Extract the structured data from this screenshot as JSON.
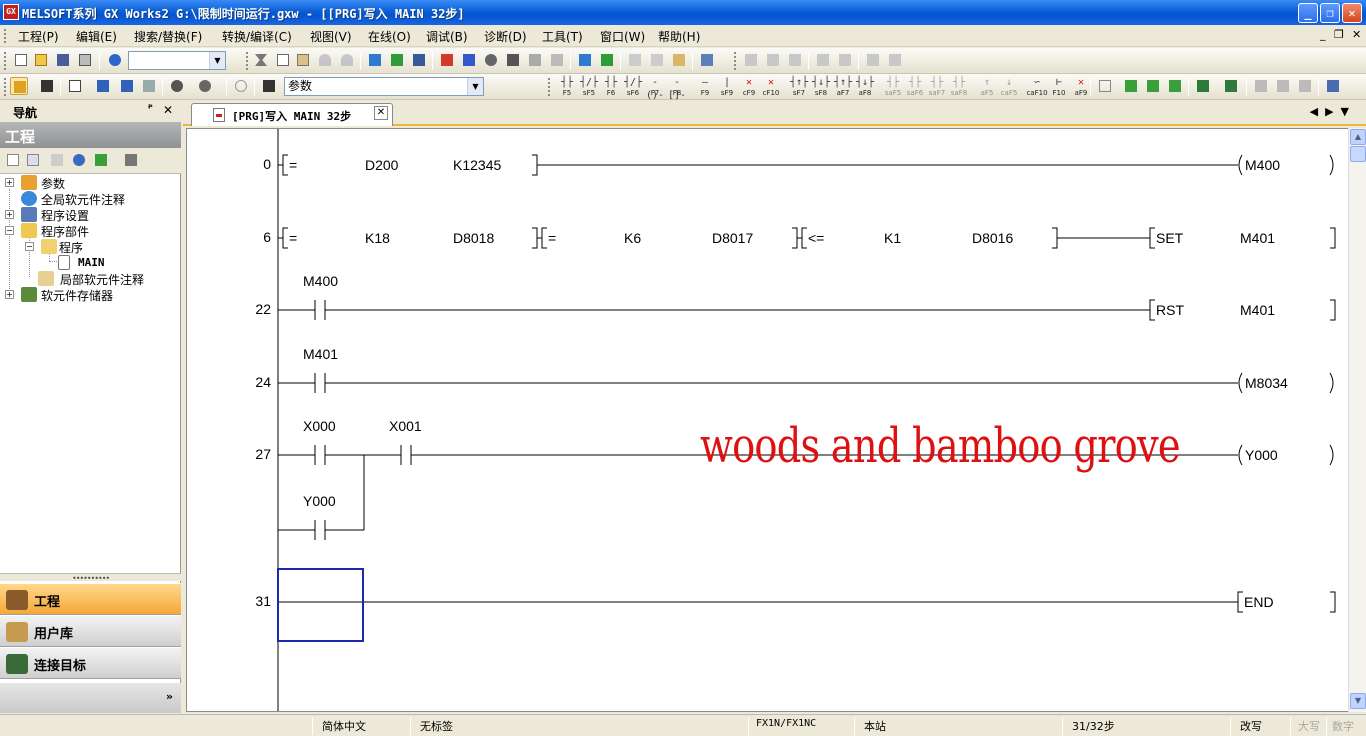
{
  "window": {
    "title": "MELSOFT系列 GX Works2 G:\\限制时间运行.gxw - [[PRG]写入 MAIN 32步]",
    "controls": [
      "minimize-button",
      "restore-button",
      "close-button"
    ]
  },
  "menu": {
    "items": [
      "工程(P)",
      "编辑(E)",
      "搜索/替换(F)",
      "转换/编译(C)",
      "视图(V)",
      "在线(O)",
      "调试(B)",
      "诊断(D)",
      "工具(T)",
      "窗口(W)",
      "帮助(H)"
    ],
    "mdi": [
      "_",
      "❐",
      "✕"
    ]
  },
  "toolbar2": {
    "combo_value": "参数"
  },
  "fkeys": [
    {
      "sym": "┤├",
      "lbl": "F5"
    },
    {
      "sym": "┤/├",
      "lbl": "sF5"
    },
    {
      "sym": "┤├",
      "lbl": "F6"
    },
    {
      "sym": "┤/├",
      "lbl": "sF6"
    },
    {
      "sym": "-()-",
      "lbl": "F7"
    },
    {
      "sym": "-[]-",
      "lbl": "F8"
    },
    {
      "sym": "—",
      "lbl": "F9"
    },
    {
      "sym": "|",
      "lbl": "sF9"
    },
    {
      "sym": "✕",
      "lbl": "cF9",
      "red": true
    },
    {
      "sym": "✕",
      "lbl": "cF10",
      "red": true
    },
    {
      "sym": "┤↑├",
      "lbl": "sF7"
    },
    {
      "sym": "┤↓├",
      "lbl": "sF8"
    },
    {
      "sym": "┤↑├",
      "lbl": "aF7"
    },
    {
      "sym": "┤↓├",
      "lbl": "aF8"
    },
    {
      "sym": "┤├",
      "lbl": "saF5",
      "dim": true
    },
    {
      "sym": "┤├",
      "lbl": "saF6",
      "dim": true
    },
    {
      "sym": "┤├",
      "lbl": "saF7",
      "dim": true
    },
    {
      "sym": "┤├",
      "lbl": "saF8",
      "dim": true
    },
    {
      "sym": "↑",
      "lbl": "aF5",
      "dim": true
    },
    {
      "sym": "↓",
      "lbl": "caF5",
      "dim": true
    },
    {
      "sym": "∽",
      "lbl": "caF10"
    },
    {
      "sym": "⊢",
      "lbl": "F10"
    },
    {
      "sym": "✕",
      "lbl": "aF9",
      "red": true
    }
  ],
  "nav": {
    "panel_title": "导航",
    "pin": "ᴾ",
    "close": "✕",
    "project_header": "工程",
    "tree": [
      {
        "label": "参数",
        "toggle": "+"
      },
      {
        "label": "全局软元件注释",
        "toggle": ""
      },
      {
        "label": "程序设置",
        "toggle": "+"
      },
      {
        "label": "程序部件",
        "toggle": "−"
      },
      {
        "label": "程序",
        "toggle": "−"
      },
      {
        "label": "MAIN",
        "toggle": ""
      },
      {
        "label": "局部软元件注释",
        "toggle": ""
      },
      {
        "label": "软元件存储器",
        "toggle": "+"
      }
    ],
    "splitter": "••••••••••",
    "buttons": [
      "工程",
      "用户库",
      "连接目标"
    ],
    "more": "»"
  },
  "tab": {
    "label": "[PRG]写入 MAIN 32步",
    "close": "✕",
    "arrows": "◀▶▼"
  },
  "ladder": {
    "rungs": [
      {
        "step": "0",
        "compare": [
          {
            "op": "=",
            "a": "D200",
            "b": "K12345"
          }
        ],
        "output": "M400",
        "out_type": "coil"
      },
      {
        "step": "6",
        "compare": [
          {
            "op": "=",
            "a": "K18",
            "b": "D8018"
          },
          {
            "op": "=",
            "a": "K6",
            "b": "D8017"
          },
          {
            "op": "<=",
            "a": "K1",
            "b": "D8016"
          }
        ],
        "output_cmd": "SET",
        "output": "M401",
        "out_type": "instr"
      },
      {
        "step": "22",
        "contact": "M400",
        "output_cmd": "RST",
        "output": "M401",
        "out_type": "instr"
      },
      {
        "step": "24",
        "contact": "M401",
        "output": "M8034",
        "out_type": "coil"
      },
      {
        "step": "27",
        "contact": "X000",
        "contact2": "X001",
        "parallel": "Y000",
        "output": "Y000",
        "out_type": "coil"
      },
      {
        "step": "31",
        "output": "END",
        "out_type": "end"
      }
    ]
  },
  "watermark": "woods and bamboo grove",
  "status": {
    "language": "简体中文",
    "label": "无标签",
    "cpu": "FX1N/FX1NC",
    "station": "本站",
    "steps": "31/32步",
    "mode": "改写",
    "caps": "大写",
    "num": "数字"
  }
}
